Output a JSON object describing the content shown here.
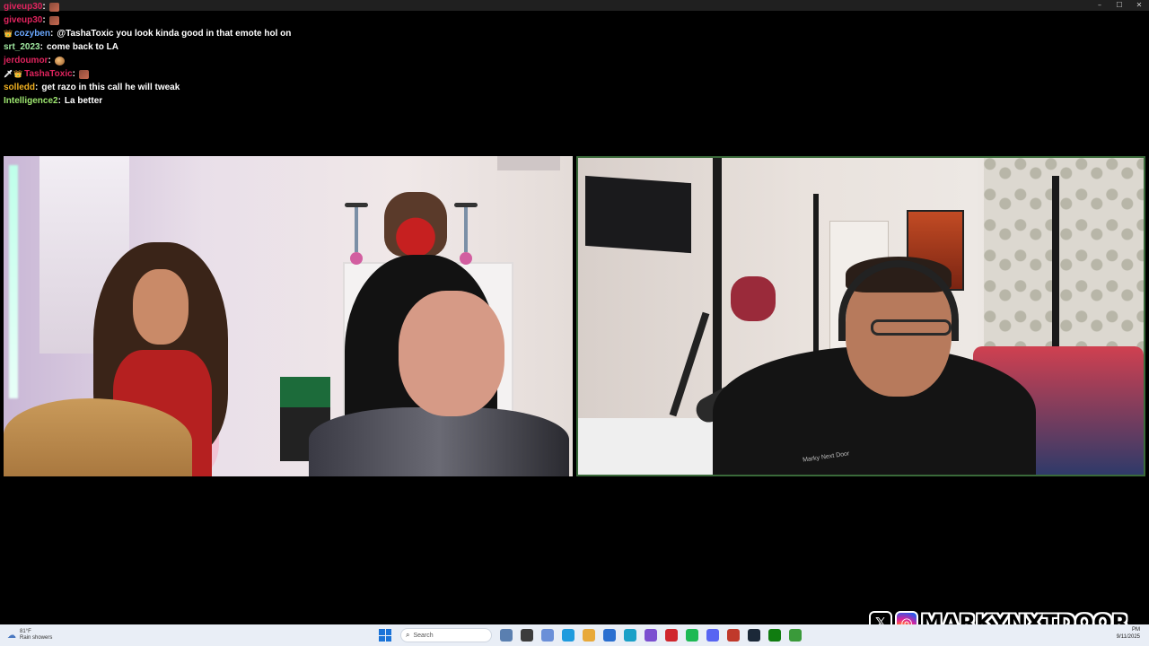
{
  "window": {
    "controls": [
      "–",
      "☐",
      "✕"
    ]
  },
  "chat": [
    {
      "user": "giveup30",
      "color": "#e0245e",
      "badges": [],
      "message": "",
      "emote": "block"
    },
    {
      "user": "giveup30",
      "color": "#e0245e",
      "badges": [],
      "message": "",
      "emote": "block"
    },
    {
      "user": "cozyben",
      "color": "#6aa8ff",
      "badges": [
        "👑"
      ],
      "message": "@TashaToxic you look kinda good in that emote hol on",
      "emote": ""
    },
    {
      "user": "srt_2023",
      "color": "#a0e8a0",
      "badges": [],
      "message": "come back to LA",
      "emote": ""
    },
    {
      "user": "jerdoumor",
      "color": "#e0245e",
      "badges": [],
      "message": "",
      "emote": "ball"
    },
    {
      "user": "TashaToxic",
      "color": "#e0245e",
      "badges": [
        "🗡",
        "👑"
      ],
      "message": "",
      "emote": "block"
    },
    {
      "user": "solledd",
      "color": "#f0b020",
      "badges": [],
      "message": "get razo in this call he will tweak",
      "emote": ""
    },
    {
      "user": "Intelligence2",
      "color": "#9fe870",
      "badges": [],
      "message": "La better",
      "emote": ""
    }
  ],
  "stream_right": {
    "shirt_text": "Marky Next Door"
  },
  "branding": {
    "handle": "MARKYNXTDOOR",
    "x_glyph": "𝕏",
    "ig_glyph": "◎"
  },
  "taskbar": {
    "weather_temp": "81°F",
    "weather_desc": "Rain showers",
    "search_placeholder": "Search",
    "time": "PM",
    "date": "9/11/2025",
    "apps": [
      "#5a7fb0",
      "#3c3c3c",
      "#6a8fd8",
      "#1f9bde",
      "#e8a93a",
      "#2a6fd0",
      "#1aa0c8",
      "#7b4fd0",
      "#d0262d",
      "#1db954",
      "#5865f2",
      "#c0392b",
      "#1b2838",
      "#107c10",
      "#3a9a3a"
    ]
  }
}
